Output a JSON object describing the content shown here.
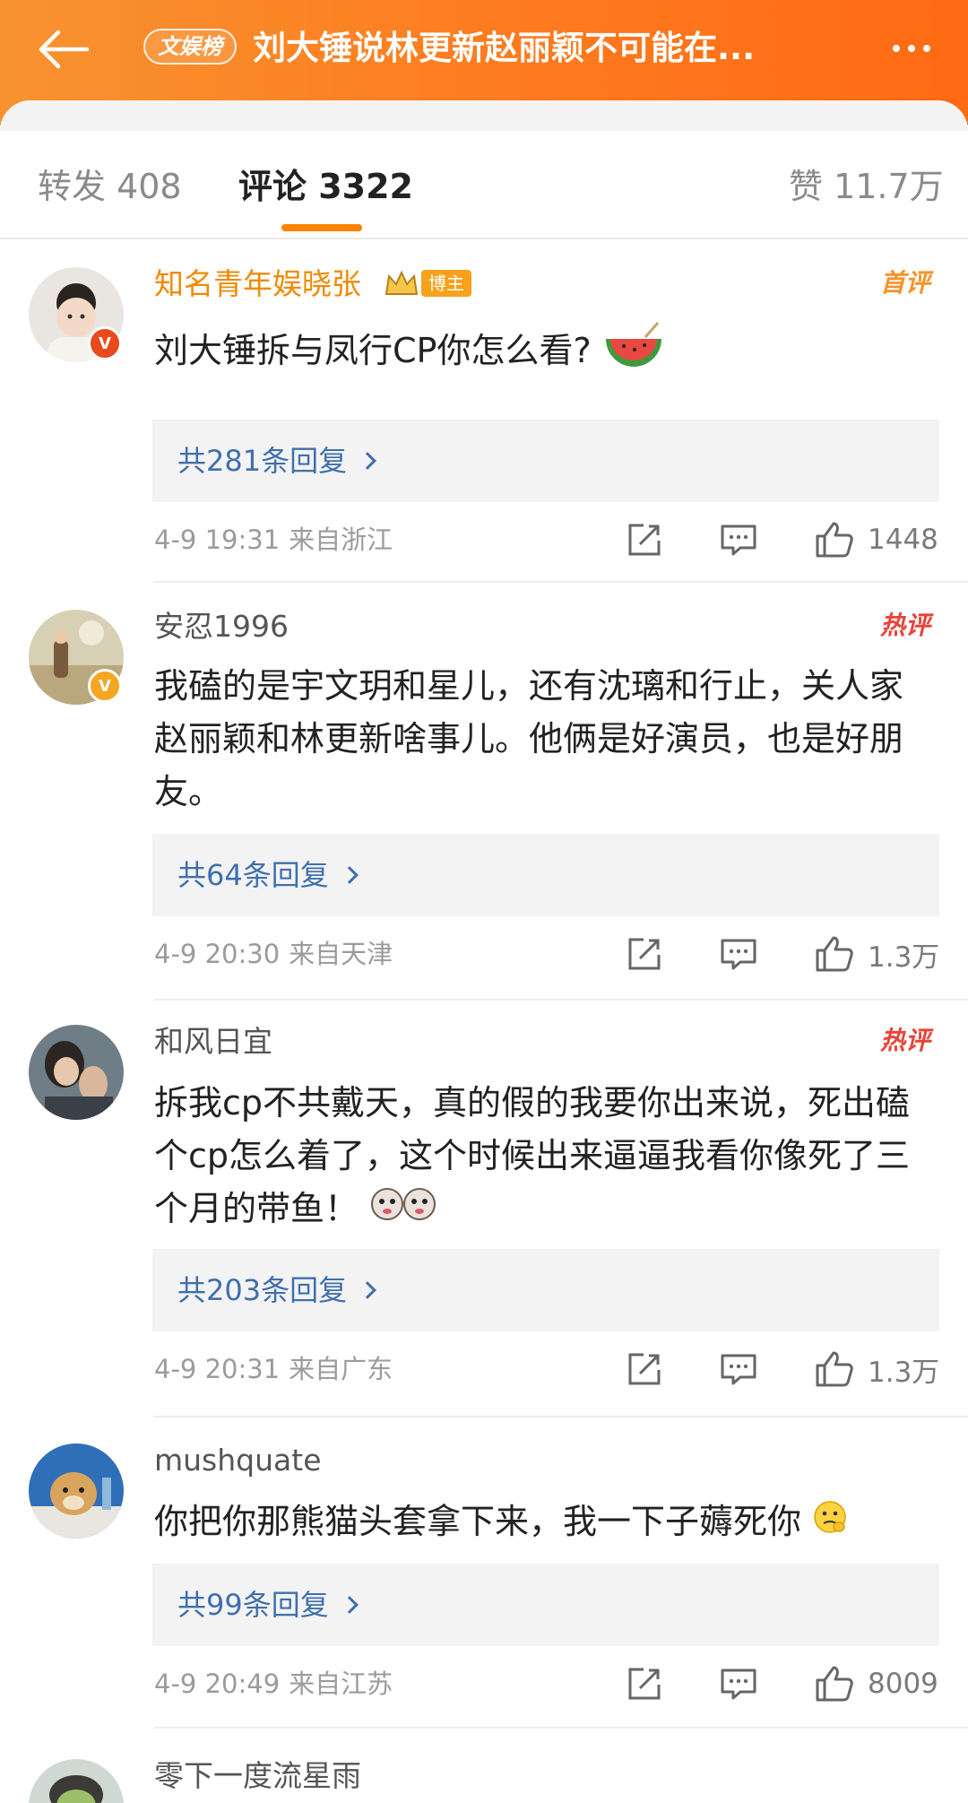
{
  "header": {
    "badge": "文娱榜",
    "title": "刘大锤说林更新赵丽颖不可能在...",
    "colors": {
      "start": "#f7932f",
      "end": "#ff6a12"
    }
  },
  "tabs": {
    "repost": "转发 408",
    "comments": "评论 3322",
    "likes": "赞 11.7万"
  },
  "comments": [
    {
      "username": "知名青年娱晓张",
      "role": "博主",
      "tag": "首评",
      "text": "刘大锤拆与凤行CP你怎么看?",
      "emoji": "watermelon",
      "replies": "共281条回复",
      "date": "4-9 19:31",
      "location": "来自浙江",
      "likes": "1448"
    },
    {
      "username": "安忍1996",
      "tag": "热评",
      "text": "我磕的是宇文玥和星儿，还有沈璃和行止，关人家赵丽颖和林更新啥事儿。他俩是好演员，也是好朋友。",
      "replies": "共64条回复",
      "date": "4-9 20:30",
      "location": "来自天津",
      "likes": "1.3万"
    },
    {
      "username": "和风日宜",
      "tag": "热评",
      "text": "拆我cp不共戴天，真的假的我要你出来说，死出磕个cp怎么着了，这个时候出来逼逼我看你像死了三个月的带鱼！",
      "emoji": "doge-doge",
      "replies": "共203条回复",
      "date": "4-9 20:31",
      "location": "来自广东",
      "likes": "1.3万"
    },
    {
      "username": "mushquate",
      "text": "你把你那熊猫头套拿下来，我一下子薅死你",
      "emoji": "thinking-face",
      "replies": "共99条回复",
      "date": "4-9 20:49",
      "location": "来自江苏",
      "likes": "8009"
    },
    {
      "username": "零下一度流星雨"
    }
  ],
  "icons": {
    "back": "back-arrow-icon",
    "more": "more-dots-icon",
    "share": "share-icon",
    "reply": "comment-icon",
    "like": "like-icon"
  }
}
